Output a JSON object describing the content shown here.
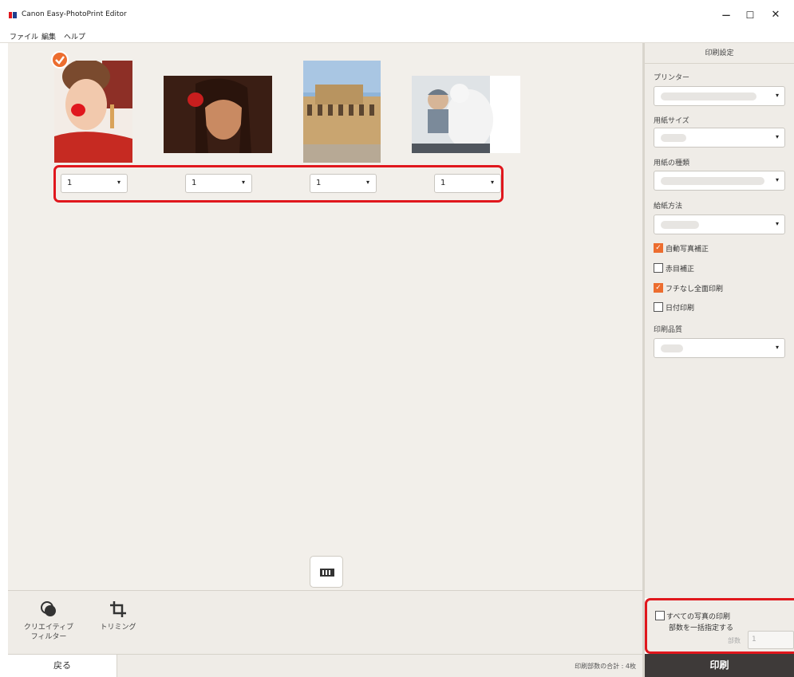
{
  "window": {
    "title": "Canon Easy-PhotoPrint Editor",
    "controls": {
      "minimize": "−",
      "maximize": "☐",
      "close": "✕"
    }
  },
  "menu": {
    "items": [
      "ファイル",
      "編集",
      "ヘルプ"
    ]
  },
  "photos": [
    {
      "name": "child-face-paint",
      "copies": "1",
      "selected": true
    },
    {
      "name": "woman-portrait",
      "copies": "1",
      "selected": false
    },
    {
      "name": "building",
      "copies": "1",
      "selected": false
    },
    {
      "name": "baby-teddy-bear",
      "copies": "1",
      "selected": false
    }
  ],
  "icons": {
    "check": "✓",
    "dropdown_arrow": "▾"
  },
  "tools": {
    "creative_filter": {
      "line1": "クリエイティブ",
      "line2": "フィルター"
    },
    "trimming": {
      "label": "トリミング"
    }
  },
  "footer": {
    "back": "戻る",
    "total": "印刷部数の合計 : 4枚"
  },
  "panel": {
    "header": "印刷設定",
    "printer_label": "プリンター",
    "paper_size_label": "用紙サイズ",
    "paper_type_label": "用紙の種類",
    "paper_source_label": "給紙方法",
    "options": [
      {
        "label": "自動写真補正",
        "checked": true
      },
      {
        "label": "赤目補正",
        "checked": false
      },
      {
        "label": "フチなし全面印刷",
        "checked": true
      },
      {
        "label": "日付印刷",
        "checked": false
      }
    ],
    "quality_label": "印刷品質"
  },
  "bulk": {
    "line1": "すべての写真の印刷",
    "line2": "部数を一括指定する",
    "copies_label": "部数",
    "copies_value": "1"
  },
  "print_button": "印刷",
  "colors": {
    "accent": "#ec6d2f",
    "highlight": "#e0171d",
    "print_button": "#3e3a39"
  }
}
